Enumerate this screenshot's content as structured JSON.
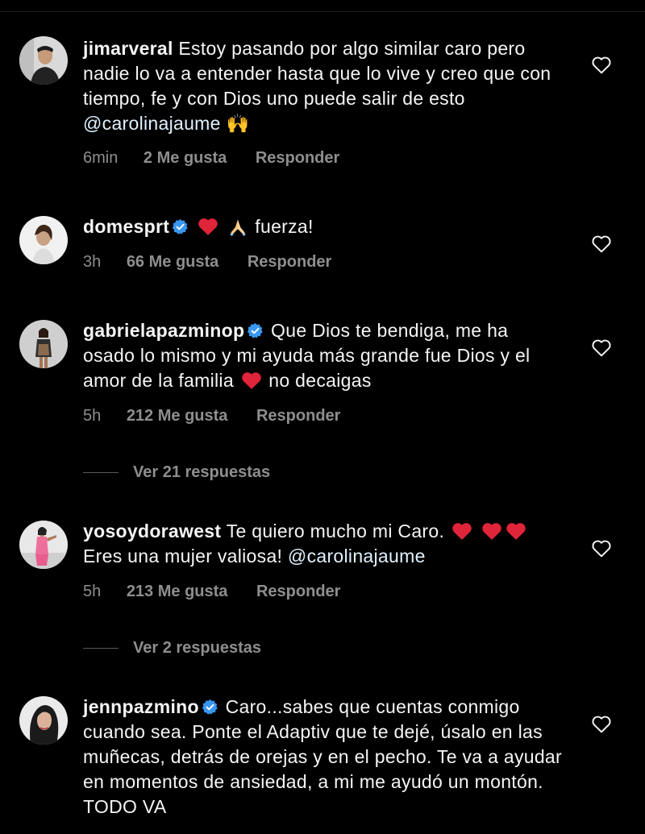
{
  "comments": [
    {
      "username": "jimarveral",
      "verified": false,
      "text_parts": [
        "Estoy pasando por algo similar caro pero nadie lo va a entender hasta que lo vive  y creo que con tiempo, fe y con Dios uno puede salir de esto ",
        "@carolinajaume",
        " 🙌"
      ],
      "time": "6min",
      "likes": "2 Me gusta",
      "reply": "Responder"
    },
    {
      "username": "domesprt",
      "verified": true,
      "text_parts": [
        " fuerza!"
      ],
      "time": "3h",
      "likes": "66 Me gusta",
      "reply": "Responder"
    },
    {
      "username": "gabrielapazminop",
      "verified": true,
      "text_parts": [
        "Que Dios te bendiga, me ha osado lo mismo y mi ayuda más grande fue Dios y el amor de la familia ",
        " no decaigas"
      ],
      "time": "5h",
      "likes": "212 Me gusta",
      "reply": "Responder",
      "view_replies": "Ver 21 respuestas"
    },
    {
      "username": "yosoydorawest",
      "verified": false,
      "text_parts": [
        "Te quiero mucho mi Caro. ",
        " Eres una mujer valiosa! ",
        "@carolinajaume"
      ],
      "time": "5h",
      "likes": "213 Me gusta",
      "reply": "Responder",
      "view_replies": "Ver 2 respuestas"
    },
    {
      "username": "jennpazmino",
      "verified": true,
      "text_parts": [
        "Caro...sabes que cuentas conmigo cuando sea. Ponte el Adaptiv que te dejé, úsalo en las muñecas, detrás de orejas y en el pecho. Te va a ayudar en momentos de ansiedad, a mi me ayudó un montón. TODO VA"
      ]
    }
  ],
  "icons": {
    "like": "heart-outline-icon",
    "verified": "verified-badge-icon",
    "heart_emoji": "red-heart-emoji-icon",
    "pray_emoji": "folded-hands-emoji-icon"
  },
  "colors": {
    "background": "#000000",
    "text": "#f5f5f5",
    "muted": "#8e8e8e",
    "verified": "#3897f0",
    "heart": "#e0243a"
  }
}
